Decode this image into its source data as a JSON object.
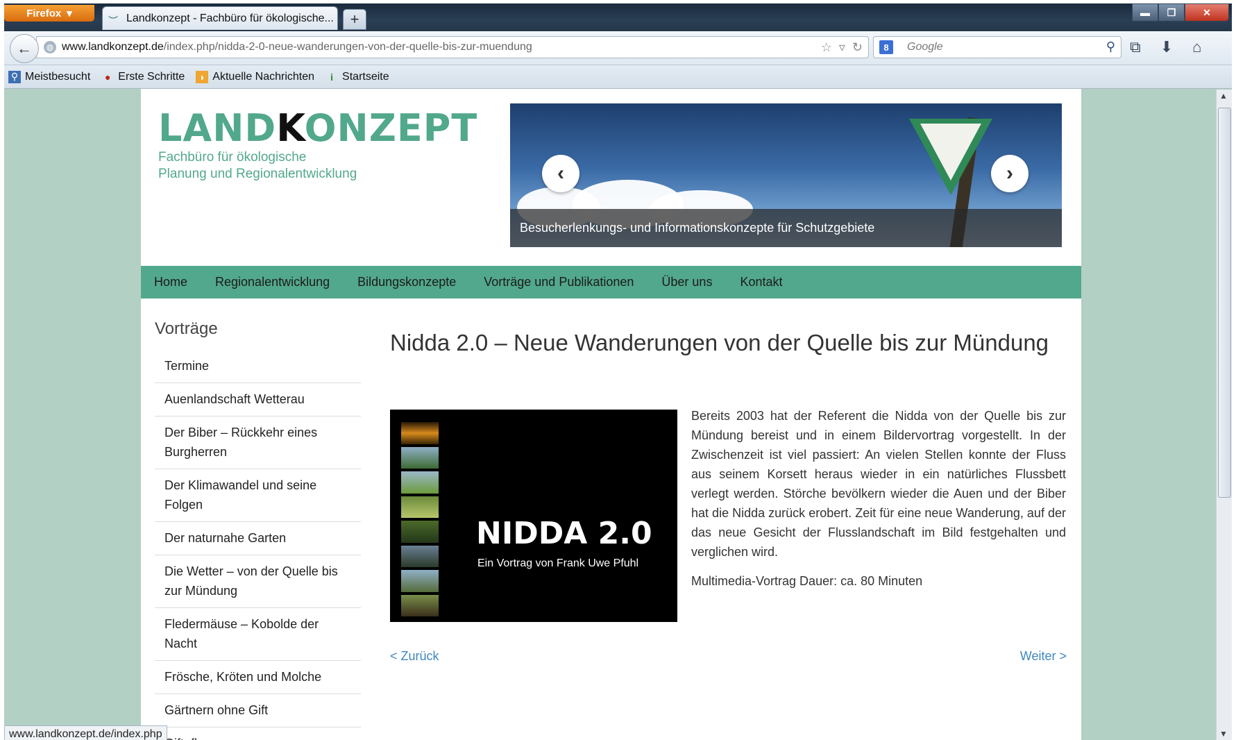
{
  "browser": {
    "menu_label": "Firefox",
    "tab_title": "Landkonzept - Fachbüro für ökologische...",
    "new_tab": "+",
    "url_domain": "www.landkonzept.de",
    "url_path": "/index.php/nidda-2-0-neue-wanderungen-von-der-quelle-bis-zur-muendung",
    "search_engine": "Google",
    "search_placeholder": "Google",
    "bookmarks": [
      "Meistbesucht",
      "Erste Schritte",
      "Aktuelle Nachrichten",
      "Startseite"
    ],
    "status_url": "www.landkonzept.de/index.php"
  },
  "site": {
    "logo_part1": "LAND",
    "logo_k": "K",
    "logo_part2": "ONZEPT",
    "tagline_1": "Fachbüro für ökologische",
    "tagline_2": "Planung und Regionalentwicklung",
    "slider_caption": "Besucherlenkungs- und Informationskonzepte für Schutzgebiete",
    "brand_color": "#52a88c"
  },
  "nav": [
    "Home",
    "Regionalentwicklung",
    "Bildungskonzepte",
    "Vorträge und Publikationen",
    "Über uns",
    "Kontakt"
  ],
  "sidebar": {
    "title": "Vorträge",
    "items": [
      "Termine",
      "Auenlandschaft Wetterau",
      "Der Biber – Rückkehr eines Burgherren",
      "Der Klimawandel und seine Folgen",
      "Der naturnahe Garten",
      "Die Wetter – von der Quelle bis zur Mündung",
      "Fledermäuse – Kobolde der Nacht",
      "Frösche, Kröten und Molche",
      "Gärtnern ohne Gift",
      "Giftpflanzen"
    ]
  },
  "article": {
    "title": "Nidda 2.0 – Neue Wanderungen von der Quelle bis zur Mündung",
    "poster_title": "NIDDA 2.0",
    "poster_subtitle": "Ein Vortrag von Frank Uwe Pfuhl",
    "body": "Bereits 2003 hat der Referent die Nidda von der Quelle bis zur Mündung bereist und in einem Bildervortrag vorgestellt. In der Zwischenzeit ist viel passiert: An vielen Stellen konnte der Fluss aus seinem Korsett heraus wieder in ein natürliches Flussbett verlegt werden. Störche bevölkern wieder die Auen und der Biber hat die Nidda zurück erobert. Zeit für eine neue Wanderung, auf der das neue Gesicht der Flusslandschaft im Bild festgehalten und verglichen wird.",
    "duration": "Multimedia-Vortrag Dauer: ca. 80 Minuten",
    "prev": "< Zurück",
    "next": "Weiter >"
  }
}
